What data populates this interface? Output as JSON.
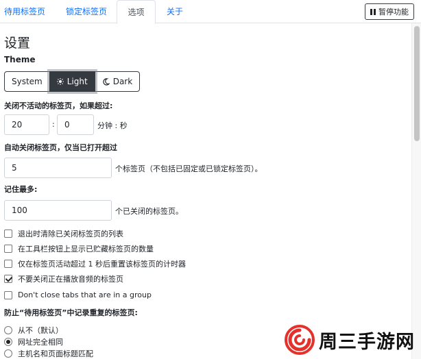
{
  "tabs": [
    {
      "label": "待用标签页",
      "active": false
    },
    {
      "label": "锁定标签页",
      "active": false
    },
    {
      "label": "选项",
      "active": true
    },
    {
      "label": "关于",
      "active": false
    }
  ],
  "pause_button": {
    "label": "暂停功能",
    "icon": "pause-icon"
  },
  "settings": {
    "heading": "设置",
    "theme": {
      "label": "Theme",
      "options": [
        {
          "label": "System",
          "icon": ""
        },
        {
          "label": "Light",
          "icon": "sun-icon"
        },
        {
          "label": "Dark",
          "icon": "moon-icon"
        }
      ],
      "selected": "Light"
    },
    "inactive": {
      "label": "关闭不活动的标签页，如果超过:",
      "minutes": "20",
      "separator": ":",
      "seconds": "0",
      "unit": "分钟 : 秒"
    },
    "auto_close": {
      "label": "自动关闭标签页，仅当已打开超过",
      "value": "5",
      "suffix": "个标签页（不包括已固定或已锁定标签页）。"
    },
    "remember": {
      "label": "记住最多:",
      "value": "100",
      "suffix": "个已关闭的标签页。"
    },
    "checkboxes": [
      {
        "label": "退出时清除已关闭标签页的列表",
        "checked": false
      },
      {
        "label": "在工具栏按钮上显示已贮藏标签页的数量",
        "checked": false
      },
      {
        "label": "仅在标签页活动超过 1 秒后重置该标签页的计时器",
        "checked": false
      },
      {
        "label": "不要关闭正在播放音频的标签页",
        "checked": true
      },
      {
        "label": "Don't close tabs that are in a group",
        "checked": false
      }
    ],
    "duplicates": {
      "label": "防止“待用标签页”中记录重复的标签页:",
      "options": [
        {
          "label": "从不（默认）",
          "checked": false
        },
        {
          "label": "网址完全相同",
          "checked": true
        },
        {
          "label": "主机名和页面标题匹配",
          "checked": false
        }
      ]
    }
  },
  "watermark": {
    "text": "周三手游网"
  },
  "colors": {
    "link": "#0d6efd",
    "dark_button": "#343a40",
    "border": "#ced4da",
    "logo_red": "#e4312b"
  }
}
